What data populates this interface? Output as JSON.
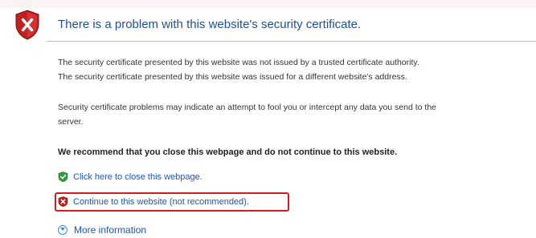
{
  "title": "There is a problem with this website's security certificate.",
  "details": [
    "The security certificate presented by this website was not issued by a trusted certificate authority.",
    "The security certificate presented by this website was issued for a different website's address."
  ],
  "warning_line1": "Security certificate problems may indicate an attempt to fool you or intercept any data you send to the",
  "warning_line2": "server.",
  "recommendation": "We recommend that you close this webpage and do not continue to this website.",
  "links": {
    "close": "Click here to close this webpage.",
    "continue": "Continue to this website (not recommended).",
    "more_info": "More information"
  },
  "colors": {
    "title": "#1f4e9e",
    "link": "#1a55c4",
    "highlight": "#d11d1d"
  },
  "icons": {
    "header": "error-shield-icon",
    "close": "green-shield-check-icon",
    "continue": "red-shield-icon",
    "more_info": "expand-circle-icon"
  }
}
